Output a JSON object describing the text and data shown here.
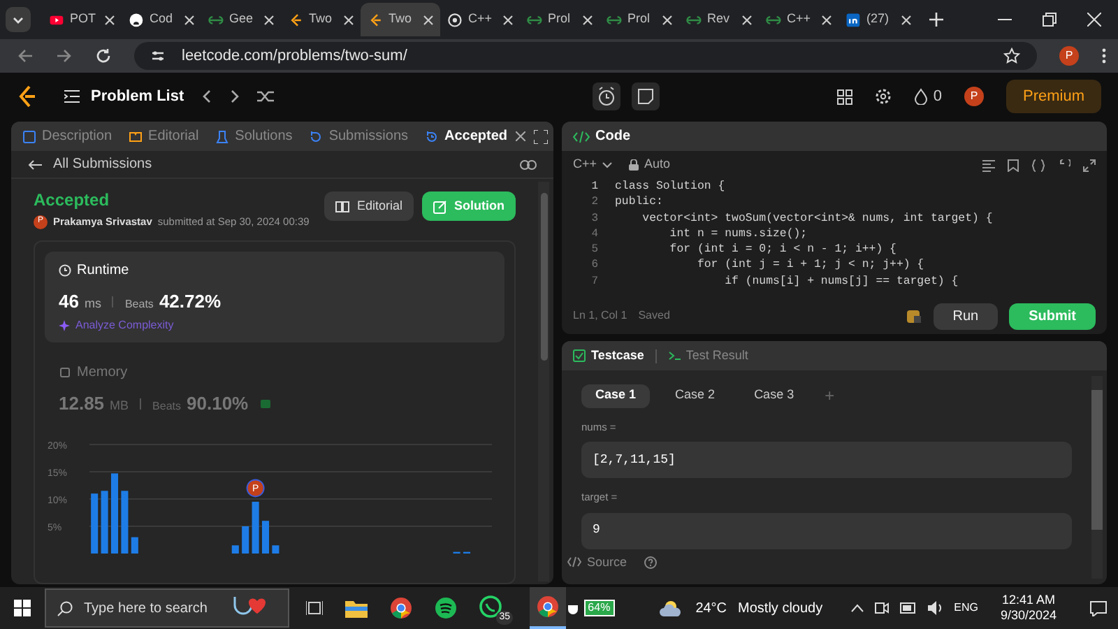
{
  "browser": {
    "tabs": [
      {
        "kind": "youtube",
        "label": "POT",
        "selected": false
      },
      {
        "kind": "github",
        "label": "Cod",
        "selected": false
      },
      {
        "kind": "gfg",
        "label": "Gee",
        "selected": false
      },
      {
        "kind": "leetcode",
        "label": "Two",
        "selected": false
      },
      {
        "kind": "leetcode",
        "label": "Two",
        "selected": true
      },
      {
        "kind": "chatgpt",
        "label": "C++",
        "selected": false
      },
      {
        "kind": "gfg",
        "label": "Prol",
        "selected": false
      },
      {
        "kind": "gfg",
        "label": "Prol",
        "selected": false
      },
      {
        "kind": "gfg",
        "label": "Rev",
        "selected": false
      },
      {
        "kind": "gfg",
        "label": "C++",
        "selected": false
      },
      {
        "kind": "linkedin",
        "label": "(27)",
        "selected": false
      }
    ],
    "url": "leetcode.com/problems/two-sum/",
    "profile": "P"
  },
  "header": {
    "problem_list": "Problem List",
    "streak": "0",
    "avatar": "P",
    "premium": "Premium"
  },
  "left_panel": {
    "tabs": [
      {
        "kind": "description",
        "label": "Description",
        "selected": false
      },
      {
        "kind": "editorial",
        "label": "Editorial",
        "selected": false
      },
      {
        "kind": "solutions",
        "label": "Solutions",
        "selected": false
      },
      {
        "kind": "submissions",
        "label": "Submissions",
        "selected": false
      },
      {
        "kind": "accepted",
        "label": "Accepted",
        "selected": true
      }
    ],
    "back_link": "All Submissions",
    "status": "Accepted",
    "avatar": "P",
    "user": "Prakamya Srivastav",
    "submitted": "submitted at Sep 30, 2024 00:39",
    "buttons": [
      {
        "kind": "secondary",
        "label": "Editorial"
      },
      {
        "kind": "primary",
        "label": "Solution"
      }
    ],
    "metrics": [
      {
        "kind": "runtime",
        "title": "Runtime",
        "value": "46",
        "unit": "ms",
        "beats_label": "Beats",
        "beats": "42.72%",
        "link": "Analyze Complexity",
        "selected": true
      },
      {
        "kind": "memory",
        "title": "Memory",
        "value": "12.85",
        "unit": "MB",
        "beats_label": "Beats",
        "beats": "90.10%",
        "selected": false
      }
    ],
    "chart_marker": "P",
    "chart_data": {
      "type": "bar",
      "grid": true,
      "yticks": [
        {
          "value": 5,
          "label": "5%"
        },
        {
          "value": 10,
          "label": "10%"
        },
        {
          "value": 15,
          "label": "15%"
        },
        {
          "value": 20,
          "label": "20%"
        }
      ],
      "ylim": [
        0,
        20
      ],
      "values": [
        11,
        11.5,
        14.7,
        11.5,
        3,
        0,
        0,
        0,
        0,
        0,
        0,
        0,
        0,
        0,
        1.5,
        5,
        9.5,
        6,
        1.5,
        0,
        0,
        0,
        0,
        0,
        0,
        0,
        0,
        0,
        0,
        0,
        0,
        0,
        0,
        0,
        0,
        0,
        0.3,
        0.3,
        0,
        0
      ]
    }
  },
  "code_panel": {
    "title": "Code",
    "language": "C++",
    "mode": "Auto",
    "lines": [
      "class Solution {",
      "public:",
      "    vector<int> twoSum(vector<int>& nums, int target) {",
      "        int n = nums.size();",
      "        for (int i = 0; i < n - 1; i++) {",
      "            for (int j = i + 1; j < n; j++) {",
      "                if (nums[i] + nums[j] == target) {"
    ],
    "line_numbers": [
      "1",
      "2",
      "3",
      "4",
      "5",
      "6",
      "7"
    ],
    "position": "Ln 1, Col 1",
    "saved": "Saved",
    "run": "Run",
    "submit": "Submit"
  },
  "test_panel": {
    "tabs": [
      {
        "label": "Testcase",
        "selected": true
      },
      {
        "label": "Test Result",
        "selected": false
      }
    ],
    "cases": [
      {
        "label": "Case 1",
        "selected": true
      },
      {
        "label": "Case 2",
        "selected": false
      },
      {
        "label": "Case 3",
        "selected": false
      }
    ],
    "add": "+",
    "params": [
      {
        "label": "nums =",
        "value": "[2,7,11,15]"
      },
      {
        "label": "target =",
        "value": "9"
      }
    ],
    "source": "Source"
  },
  "taskbar": {
    "search_placeholder": "Type here to search",
    "whatsapp_badge": "35",
    "battery": "64%",
    "temperature": "24°C",
    "weather": "Mostly cloudy",
    "language": "ENG",
    "time": "12:41 AM",
    "date": "9/30/2024"
  }
}
